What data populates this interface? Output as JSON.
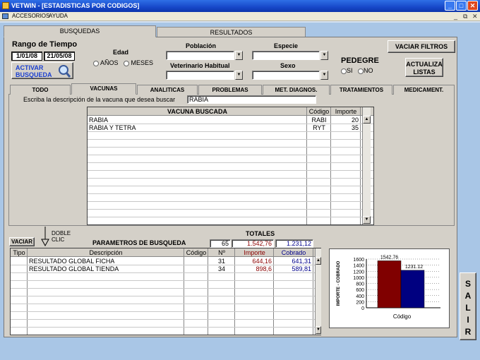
{
  "window": {
    "title": "VETWIN - [ESTADISTICAS POR CODIGOS]",
    "minimize": "_",
    "maximize": "□",
    "close": "✕"
  },
  "menu": {
    "items": [
      "ACCESORIOS",
      "AYUDA"
    ],
    "mdi_min": "_",
    "mdi_restore": "⧉",
    "mdi_close": "✕"
  },
  "main_tabs": {
    "busquedas": "BUSQUEDAS",
    "resultados": "RESULTADOS"
  },
  "time_range": {
    "label": "Rango de Tiempo",
    "from": "1/01/08",
    "to": "21/05/08"
  },
  "activar": {
    "line1": "ACTIVAR",
    "line2": "BUSQUEDA"
  },
  "edad": {
    "label": "Edad",
    "opt_years": "AÑOS",
    "opt_months": "MESES"
  },
  "filters": {
    "poblacion": "Población",
    "especie": "Especie",
    "veterinario": "Veterinario Habitual",
    "sexo": "Sexo",
    "pedegre": "PEDEGRE",
    "si": "SI",
    "no": "NO"
  },
  "buttons": {
    "vaciar_filtros": "VACIAR FILTROS",
    "actualiza_1": "ACTUALIZA",
    "actualiza_2": "LISTAS",
    "vaciar": "VACIAR",
    "salir": [
      "S",
      "A",
      "L",
      "I",
      "R"
    ]
  },
  "sub_tabs": [
    "TODO",
    "VACUNAS",
    "ANALITICAS",
    "PROBLEMAS",
    "MET. DIAGNOS.",
    "TRATAMIENTOS",
    "MEDICAMENT."
  ],
  "search": {
    "label": "Escriba la descripción de la vacuna que desea buscar",
    "value": "RABIA"
  },
  "vaccine_table": {
    "headers": [
      "VACUNA   BUSCADA",
      "Código",
      "Importe"
    ],
    "rows": [
      [
        "RABIA",
        "RABI",
        "20"
      ],
      [
        "RABIA Y TETRA",
        "RYT",
        "35"
      ]
    ]
  },
  "doble_clic": {
    "line1": "DOBLE",
    "line2": "CLIC"
  },
  "params": {
    "label": "PARAMETROS DE BUSQUEDA"
  },
  "totales": {
    "label": "TOTALES",
    "count": "65",
    "importe": "1.542,76",
    "cobrado": "1.231,12"
  },
  "result_table": {
    "headers": [
      "Tipo",
      "Descripción",
      "Código",
      "Nº",
      "Importe",
      "Cobrado"
    ],
    "rows": [
      [
        "",
        "RESULTADO GLOBAL FICHA",
        "",
        "31",
        "644,16",
        "641,31"
      ],
      [
        "",
        "RESULTADO GLOBAL TIENDA",
        "",
        "34",
        "898,6",
        "589,81"
      ]
    ]
  },
  "colors": {
    "importe": "#8b0000",
    "cobrado": "#00008b",
    "importe_bar": "#800000",
    "cobrado_bar": "#000080"
  },
  "chart_data": {
    "type": "bar",
    "title": "",
    "xlabel": "Código",
    "ylabel": "IMPORTE - COBRADO",
    "ylim": [
      0,
      1600
    ],
    "yticks": [
      0,
      200,
      400,
      600,
      800,
      1000,
      1200,
      1400,
      1600
    ],
    "categories": [
      ""
    ],
    "series": [
      {
        "name": "",
        "values": [
          1542.76
        ]
      },
      {
        "name": "",
        "values": [
          1231.12
        ]
      }
    ],
    "data_labels": [
      "1542.76",
      "1231.12"
    ],
    "grid": true
  }
}
